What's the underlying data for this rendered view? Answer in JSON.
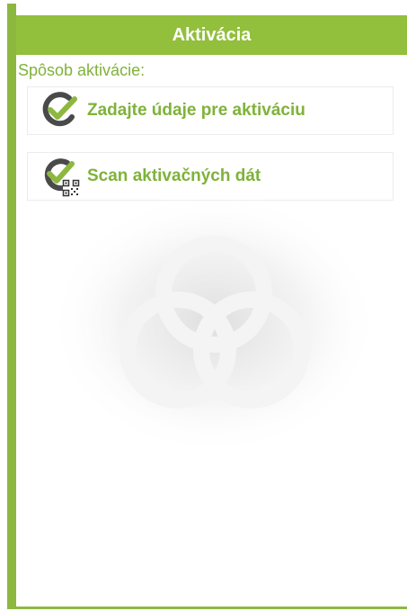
{
  "header": {
    "title": "Aktivácia"
  },
  "main": {
    "section_label": "Spôsob aktivácie:",
    "options": [
      {
        "label": "Zadajte údaje pre aktiváciu",
        "icon": "check-circle-icon"
      },
      {
        "label": "Scan aktivačných dát",
        "icon": "check-circle-qr-icon"
      }
    ]
  },
  "colors": {
    "accent": "#92bf3c",
    "text_accent": "#7fb23a",
    "icon_dark": "#4a4a4a"
  }
}
